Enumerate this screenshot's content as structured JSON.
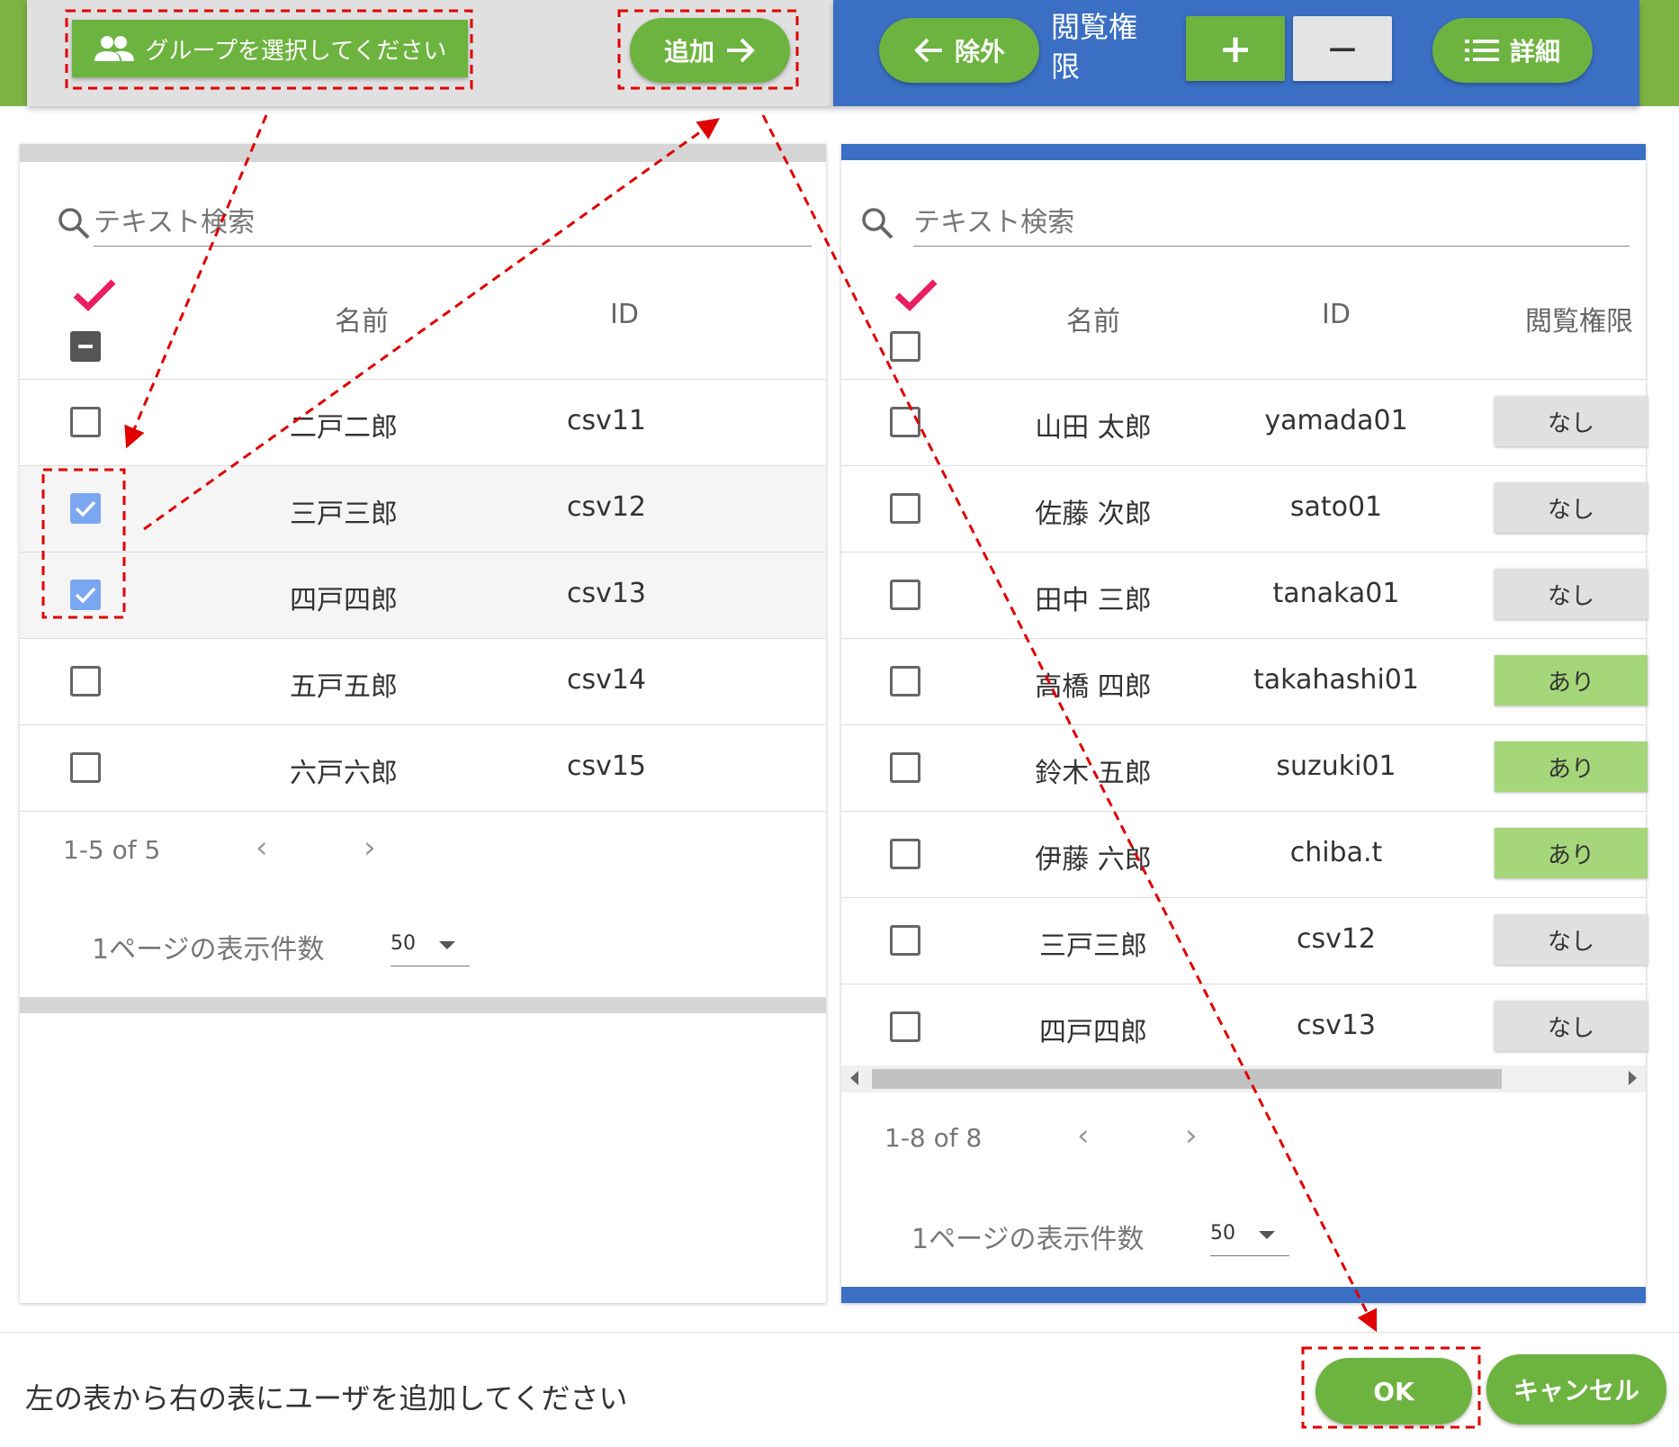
{
  "header": {
    "group_select_label": "グループを選択してください",
    "add_label": "追加",
    "remove_label": "除外",
    "permission_label": "閲覧権限",
    "plus_label": "+",
    "minus_label": "−",
    "detail_label": "詳細"
  },
  "left_table": {
    "search_placeholder": "テキスト検索",
    "columns": {
      "name": "名前",
      "id": "ID"
    },
    "rows": [
      {
        "name": "二戸二郎",
        "id": "csv11",
        "checked": false
      },
      {
        "name": "三戸三郎",
        "id": "csv12",
        "checked": true
      },
      {
        "name": "四戸四郎",
        "id": "csv13",
        "checked": true
      },
      {
        "name": "五戸五郎",
        "id": "csv14",
        "checked": false
      },
      {
        "name": "六戸六郎",
        "id": "csv15",
        "checked": false
      }
    ],
    "pagination": "1-5 of 5",
    "per_page_label": "1ページの表示件数",
    "per_page_value": "50"
  },
  "right_table": {
    "search_placeholder": "テキスト検索",
    "columns": {
      "name": "名前",
      "id": "ID",
      "permission": "閲覧権限"
    },
    "rows": [
      {
        "name": "山田 太郎",
        "id": "yamada01",
        "permission": "なし"
      },
      {
        "name": "佐藤 次郎",
        "id": "sato01",
        "permission": "なし"
      },
      {
        "name": "田中 三郎",
        "id": "tanaka01",
        "permission": "なし"
      },
      {
        "name": "高橋 四郎",
        "id": "takahashi01",
        "permission": "あり"
      },
      {
        "name": "鈴木 五郎",
        "id": "suzuki01",
        "permission": "あり"
      },
      {
        "name": "伊藤 六郎",
        "id": "chiba.t",
        "permission": "あり"
      },
      {
        "name": "三戸三郎",
        "id": "csv12",
        "permission": "なし"
      },
      {
        "name": "四戸四郎",
        "id": "csv13",
        "permission": "なし"
      }
    ],
    "pagination": "1-8 of 8",
    "per_page_label": "1ページの表示件数",
    "per_page_value": "50"
  },
  "footer": {
    "message": "左の表から右の表にユーザを追加してください",
    "ok_label": "OK",
    "cancel_label": "キャンセル"
  },
  "colors": {
    "green": "#6db33f",
    "blue": "#3a6fc4",
    "checkbox_checked": "#7aa7f0",
    "permission_yes": "#a5d67a",
    "permission_no": "#e0e0e0",
    "check_mark": "#e91e63",
    "annotation": "#e00000"
  }
}
